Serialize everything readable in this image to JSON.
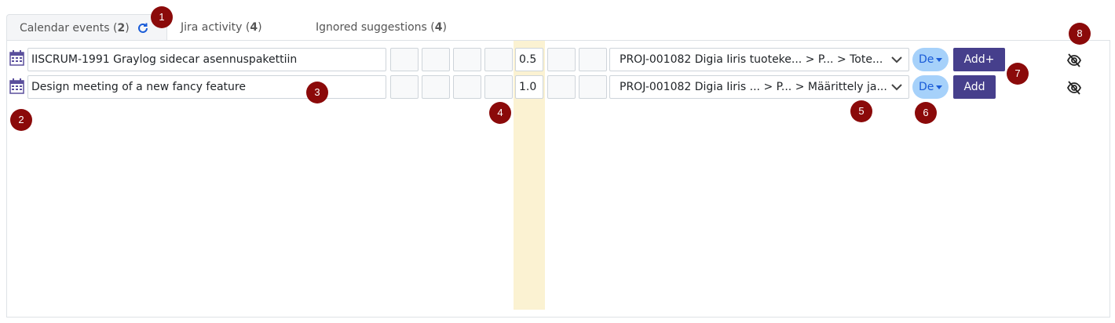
{
  "tabs": [
    {
      "label": "Calendar events",
      "count": "2"
    },
    {
      "label": "Jira activity",
      "count": "4"
    },
    {
      "label": "Ignored suggestions",
      "count": "4"
    }
  ],
  "rows": [
    {
      "title": "IISCRUM-1991 Graylog sidecar asennuspakettiin",
      "hours_value": "0.5",
      "project": "PROJ-001082 Digia Iiris tuoteke... > P... > Tote...",
      "lang": "De",
      "add_label": "Add+"
    },
    {
      "title": "Design meeting of a new fancy feature",
      "hours_value": "1.0",
      "project": "PROJ-001082 Digia Iiris ... > P... > Määrittely ja...",
      "lang": "De",
      "add_label": "Add"
    }
  ],
  "markers": [
    "1",
    "2",
    "3",
    "4",
    "5",
    "6",
    "7",
    "8"
  ],
  "icons": {
    "calendar": "calendar-icon",
    "refresh": "refresh-icon",
    "chevron": "chevron-down-icon",
    "hide": "eye-slash-icon"
  },
  "colors": {
    "accent_button": "#463f8c",
    "lang_pill": "#a6d1fa",
    "highlight_column": "#fbf2d2",
    "marker": "#8b0a0a"
  }
}
